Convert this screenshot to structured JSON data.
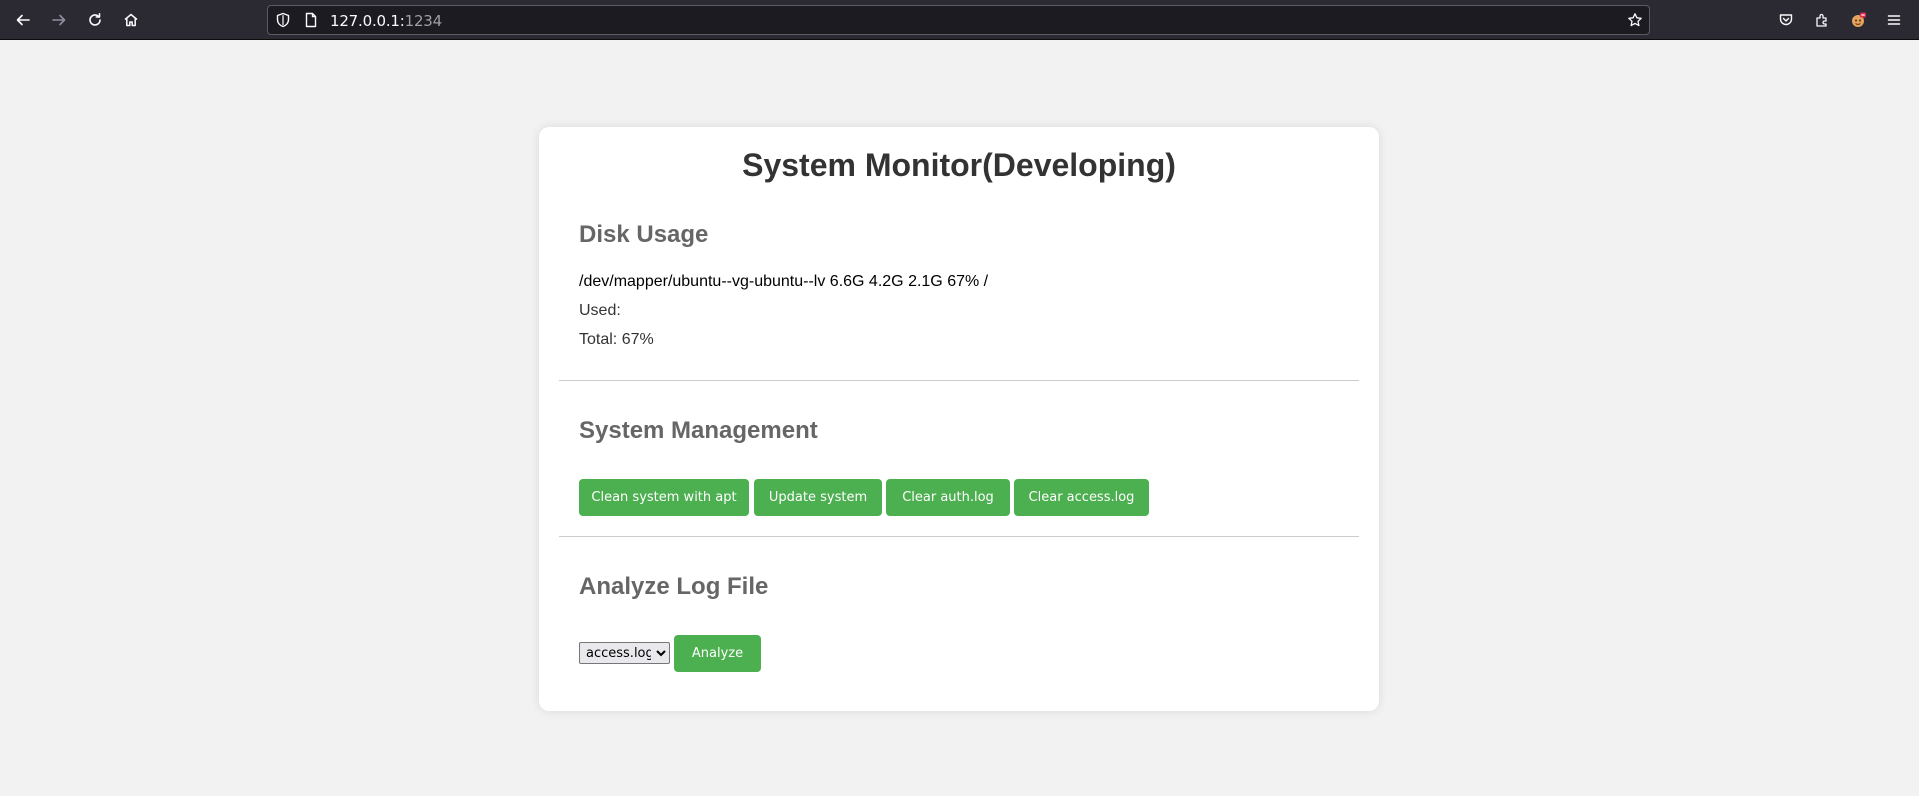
{
  "browser": {
    "url_host": "127.0.0.1:",
    "url_port": "1234",
    "icons": [
      "back-arrow-icon",
      "forward-arrow-icon",
      "reload-icon",
      "home-icon",
      "shield-icon",
      "page-icon",
      "bookmark-star-icon",
      "pocket-icon",
      "extensions-icon",
      "profile-icon",
      "menu-icon"
    ],
    "colors": {
      "toolbar": "#2b2a33",
      "urlbar": "#1c1b22"
    }
  },
  "page": {
    "title": "System Monitor(Developing)",
    "disk": {
      "heading": "Disk Usage",
      "device_line": "/dev/mapper/ubuntu--vg-ubuntu--lv 6.6G 4.2G 2.1G 67% /",
      "used_label": "Used:",
      "total_label": "Total: 67%"
    },
    "management": {
      "heading": "System Management",
      "buttons": [
        "Clean system with apt",
        "Update system",
        "Clear auth.log",
        "Clear access.log"
      ]
    },
    "analyze": {
      "heading": "Analyze Log File",
      "selected_option": "access.log",
      "button": "Analyze"
    },
    "colors": {
      "accent": "#4caf50",
      "background": "#f2f2f2",
      "card": "#ffffff"
    }
  }
}
